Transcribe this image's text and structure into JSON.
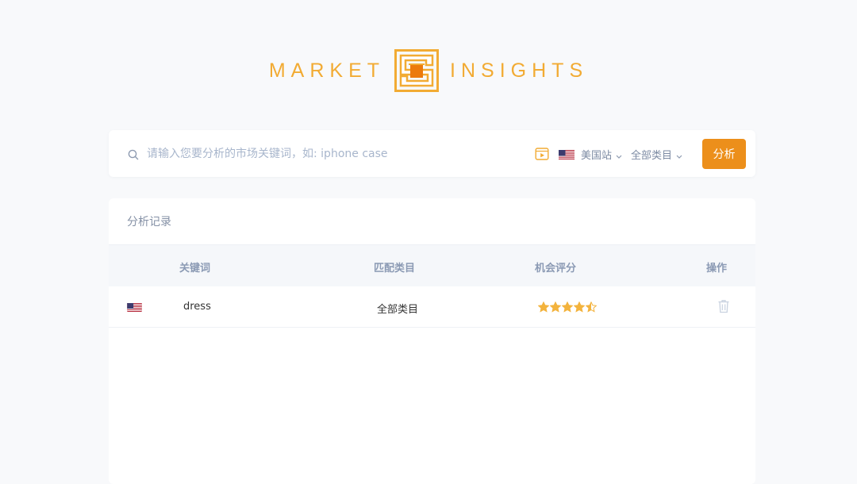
{
  "logo": {
    "left_word": "MARKET",
    "right_word": "INSIGHTS",
    "brand_color": "#f2ab33"
  },
  "search": {
    "icon": "search-icon",
    "placeholder": "请输入您要分析的市场关键词，如: iphone case",
    "value": "",
    "tutorial_icon": "video-play-icon",
    "market": {
      "flag": "us-flag",
      "label": "美国站"
    },
    "category": {
      "label": "全部类目"
    },
    "submit_label": "分析",
    "accent_color": "#ec8f1b"
  },
  "records": {
    "title": "分析记录",
    "columns": {
      "keyword": "关键词",
      "category": "匹配类目",
      "score": "机会评分",
      "action": "操作"
    },
    "rows": [
      {
        "flag": "us-flag",
        "keyword": "dress",
        "category": "全部类目",
        "rating": 4.5,
        "rating_max": 5,
        "action_icon": "trash-icon"
      }
    ]
  }
}
